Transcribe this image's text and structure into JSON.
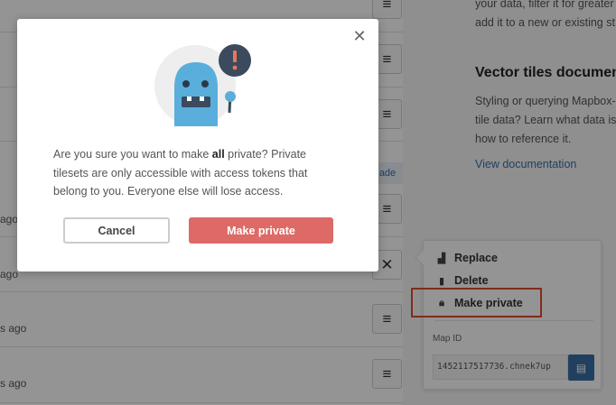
{
  "background": {
    "rows": [
      {
        "time": ""
      },
      {
        "time": ""
      },
      {
        "time": ""
      },
      {
        "time": ""
      },
      {
        "time": "ago"
      },
      {
        "time": "ago"
      },
      {
        "time": "s ago"
      },
      {
        "time": "s ago"
      }
    ],
    "upload_hint": "ade",
    "right_panel": {
      "intro_line1": "your data, filter it for greater",
      "intro_line2": "add it to a new or existing st",
      "heading": "Vector tiles documen",
      "para_line1": "Styling or querying Mapbox-",
      "para_line2": "tile data? Learn what data is",
      "para_line3": "how to reference it.",
      "link": "View documentation"
    },
    "dropdown": {
      "items": [
        {
          "label": "Replace",
          "icon": "upload-icon"
        },
        {
          "label": "Delete",
          "icon": "trash-icon"
        },
        {
          "label": "Make private",
          "icon": "lock-icon"
        }
      ],
      "mapid_label": "Map ID",
      "mapid_value": "1452117517736.chnek7up"
    }
  },
  "modal": {
    "message_before": "Are you sure you want to make ",
    "message_bold": "all",
    "message_after": " private? Private tilesets are only accessible with access tokens that belong to you. Everyone else will lose access.",
    "cancel_label": "Cancel",
    "confirm_label": "Make private"
  },
  "colors": {
    "confirm": "#dd6a66",
    "highlight": "#e04a2f",
    "link": "#3a6ea5"
  }
}
